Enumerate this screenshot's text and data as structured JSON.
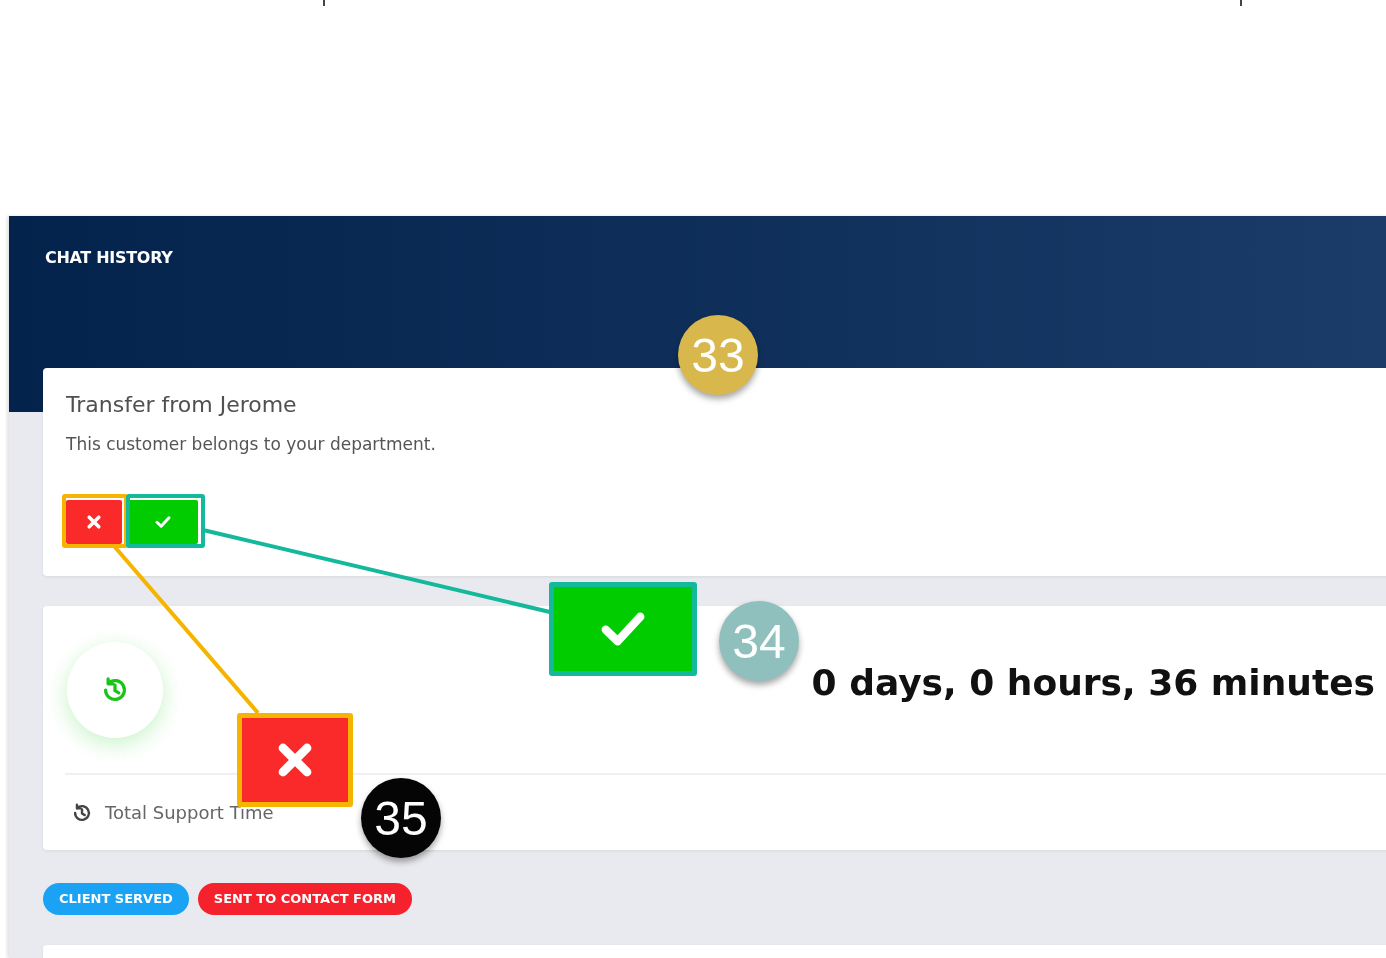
{
  "header": {
    "title": "CHAT HISTORY"
  },
  "transfer_card": {
    "title": "Transfer from Jerome",
    "message": "This customer belongs to your department.",
    "buttons": [
      {
        "kind": "reject"
      },
      {
        "kind": "accept"
      }
    ]
  },
  "support_card": {
    "duration": "0 days, 0 hours, 36 minutes",
    "label": "Total Support Time"
  },
  "tags": [
    {
      "label": "CLIENT SERVED",
      "color": "#1aa3f5"
    },
    {
      "label": "SENT TO CONTACT FORM",
      "color": "#f5222d"
    }
  ],
  "callouts": [
    {
      "number": "33",
      "color": "#d8b84c"
    },
    {
      "number": "34",
      "color": "#8fc0bd"
    },
    {
      "number": "35",
      "color": "#050505"
    }
  ]
}
